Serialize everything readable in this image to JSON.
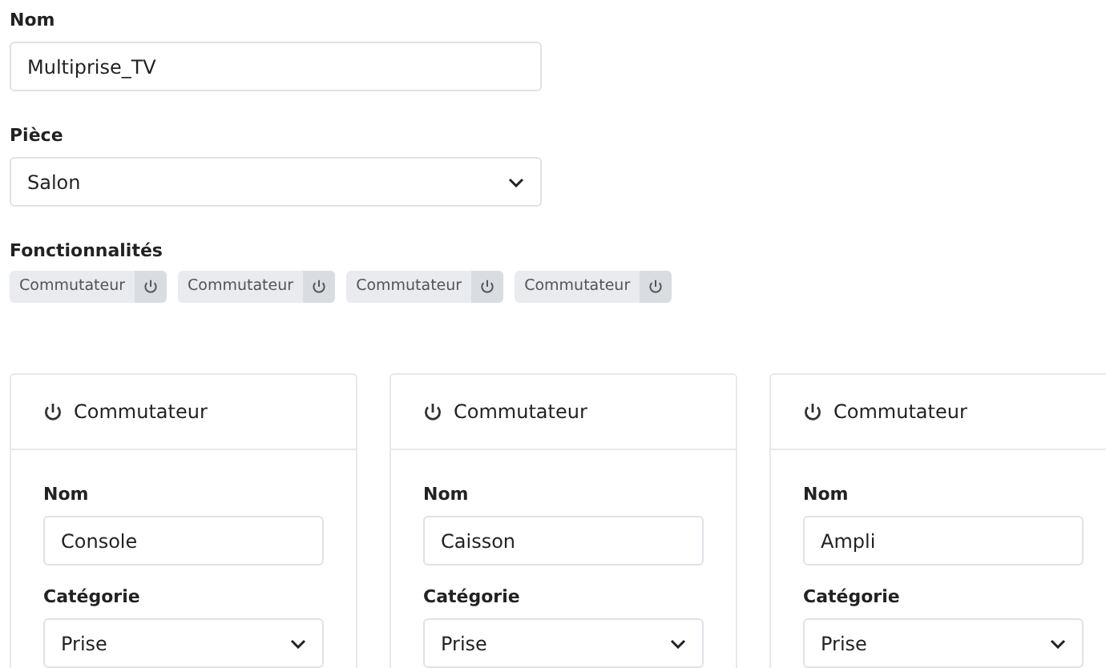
{
  "name_field": {
    "label": "Nom",
    "value": "Multiprise_TV"
  },
  "room_field": {
    "label": "Pièce",
    "value": "Salon"
  },
  "features": {
    "label": "Fonctionnalités",
    "tags": [
      {
        "label": "Commutateur"
      },
      {
        "label": "Commutateur"
      },
      {
        "label": "Commutateur"
      },
      {
        "label": "Commutateur"
      }
    ]
  },
  "cards": [
    {
      "title": "Commutateur",
      "name_label": "Nom",
      "name_value": "Console",
      "category_label": "Catégorie",
      "category_value": "Prise"
    },
    {
      "title": "Commutateur",
      "name_label": "Nom",
      "name_value": "Caisson",
      "category_label": "Catégorie",
      "category_value": "Prise"
    },
    {
      "title": "Commutateur",
      "name_label": "Nom",
      "name_value": "Ampli",
      "category_label": "Catégorie",
      "category_value": "Prise"
    }
  ]
}
